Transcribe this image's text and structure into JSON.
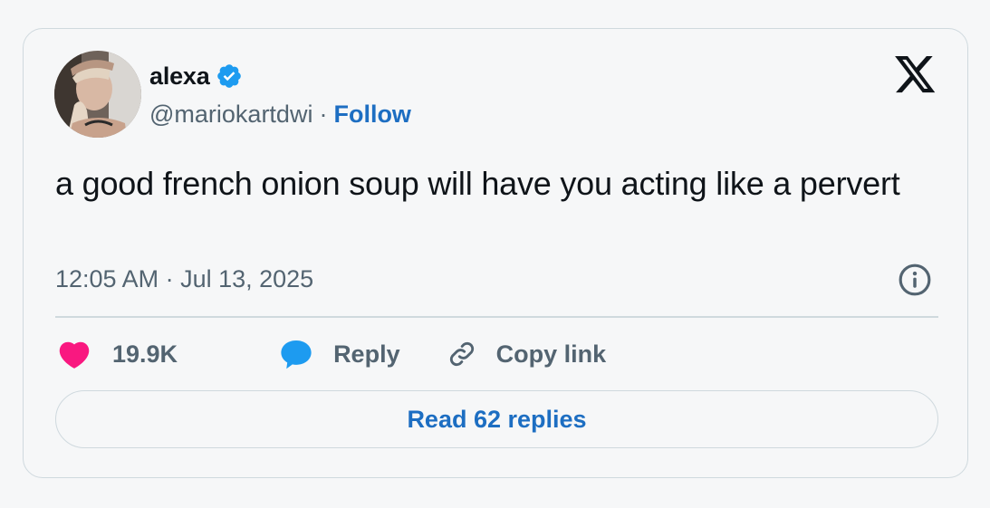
{
  "author": {
    "name": "alexa",
    "handle": "@mariokartdwi",
    "separator": "·",
    "follow_label": "Follow",
    "verified": true,
    "verified_color": "#1d9bf0"
  },
  "tweet": {
    "text": "a good french onion soup will have you acting like a pervert",
    "timestamp": "12:05 AM · Jul 13, 2025"
  },
  "actions": {
    "like_count": "19.9K",
    "reply_label": "Reply",
    "copy_link_label": "Copy link"
  },
  "read_replies_label": "Read 62 replies",
  "icons": {
    "brand": "x-logo-icon",
    "info": "info-icon",
    "like": "heart-icon",
    "reply": "speech-bubble-icon",
    "copy_link": "link-icon"
  },
  "colors": {
    "accent": "#1d6ec2",
    "like": "#f91880",
    "reply": "#1d9bf0",
    "muted": "#536471",
    "border": "#cfd9de"
  }
}
